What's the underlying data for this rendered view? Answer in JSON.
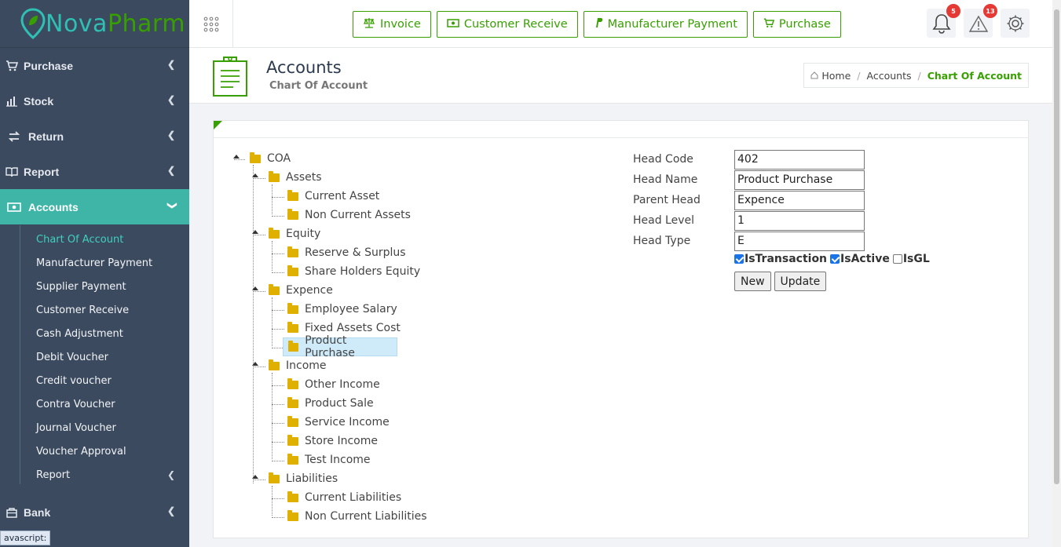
{
  "logo": {
    "part1": "Nova",
    "part2": "Pharm"
  },
  "sidebar": {
    "items": [
      {
        "label": "Purchase",
        "icon": "cart-icon"
      },
      {
        "label": "Stock",
        "icon": "bar-chart-icon"
      },
      {
        "label": "Return",
        "icon": "swap-icon"
      },
      {
        "label": "Report",
        "icon": "book-icon"
      },
      {
        "label": "Accounts",
        "icon": "money-icon",
        "active": true
      },
      {
        "label": "Bank",
        "icon": "bank-icon"
      }
    ],
    "accounts_sub": [
      "Chart Of Account",
      "Manufacturer Payment",
      "Supplier Payment",
      "Customer Receive",
      "Cash Adjustment",
      "Debit Voucher",
      "Credit voucher",
      "Contra Voucher",
      "Journal Voucher",
      "Voucher Approval",
      "Report"
    ],
    "status_tip": "avascript:"
  },
  "topbar": {
    "buttons": [
      {
        "label": "Invoice",
        "icon": "balance-scale-icon"
      },
      {
        "label": "Customer Receive",
        "icon": "money-icon"
      },
      {
        "label": "Manufacturer Payment",
        "icon": "paypal-icon"
      },
      {
        "label": "Purchase",
        "icon": "cart-icon"
      }
    ],
    "notifications_count": "5",
    "alerts_count": "13"
  },
  "header": {
    "title": "Accounts",
    "subtitle": "Chart Of Account",
    "breadcrumb": {
      "home": "Home",
      "section": "Accounts",
      "current": "Chart Of Account"
    }
  },
  "tree": {
    "root": "COA",
    "groups": [
      {
        "label": "Assets",
        "children": [
          "Current Asset",
          "Non Current Assets"
        ]
      },
      {
        "label": "Equity",
        "children": [
          "Reserve & Surplus",
          "Share Holders Equity"
        ]
      },
      {
        "label": "Expence",
        "children": [
          "Employee Salary",
          "Fixed Assets Cost",
          "Product Purchase"
        ]
      },
      {
        "label": "Income",
        "children": [
          "Other Income",
          "Product Sale",
          "Service Income",
          "Store Income",
          "Test Income"
        ]
      },
      {
        "label": "Liabilities",
        "children": [
          "Current Liabilities",
          "Non Current Liabilities"
        ]
      }
    ],
    "selected": "Product Purchase"
  },
  "form": {
    "head_code_label": "Head Code",
    "head_code": "402",
    "head_name_label": "Head Name",
    "head_name": "Product Purchase",
    "parent_head_label": "Parent Head",
    "parent_head": "Expence",
    "head_level_label": "Head Level",
    "head_level": "1",
    "head_type_label": "Head Type",
    "head_type": "E",
    "is_transaction_label": "IsTransaction",
    "is_transaction": true,
    "is_active_label": "IsActive",
    "is_active": true,
    "is_gl_label": "IsGL",
    "is_gl": false,
    "new_label": "New",
    "update_label": "Update"
  }
}
